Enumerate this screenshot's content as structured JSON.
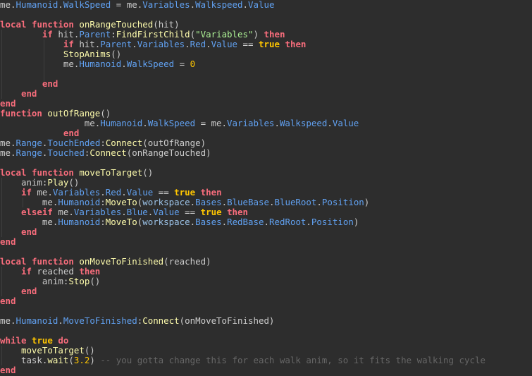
{
  "code": {
    "lines": [
      [
        [
          "plain",
          "me."
        ],
        [
          "prop",
          "Humanoid"
        ],
        [
          "plain",
          "."
        ],
        [
          "prop",
          "WalkSpeed"
        ],
        [
          "plain",
          " = me."
        ],
        [
          "prop",
          "Variables"
        ],
        [
          "plain",
          "."
        ],
        [
          "prop",
          "Walkspeed"
        ],
        [
          "plain",
          "."
        ],
        [
          "prop",
          "Value"
        ]
      ],
      [],
      [
        [
          "kw",
          "local"
        ],
        [
          "plain",
          " "
        ],
        [
          "kw",
          "function"
        ],
        [
          "plain",
          " "
        ],
        [
          "fn",
          "onRangeTouched"
        ],
        [
          "plain",
          "(hit)"
        ]
      ],
      [
        [
          "plain",
          "        "
        ],
        [
          "kw",
          "if"
        ],
        [
          "plain",
          " hit."
        ],
        [
          "prop",
          "Parent"
        ],
        [
          "plain",
          ":"
        ],
        [
          "fn",
          "FindFirstChild"
        ],
        [
          "plain",
          "("
        ],
        [
          "str",
          "\"Variables\""
        ],
        [
          "plain",
          ") "
        ],
        [
          "kw",
          "then"
        ]
      ],
      [
        [
          "plain",
          "            "
        ],
        [
          "kw",
          "if"
        ],
        [
          "plain",
          " hit."
        ],
        [
          "prop",
          "Parent"
        ],
        [
          "plain",
          "."
        ],
        [
          "prop",
          "Variables"
        ],
        [
          "plain",
          "."
        ],
        [
          "prop",
          "Red"
        ],
        [
          "plain",
          "."
        ],
        [
          "prop",
          "Value"
        ],
        [
          "plain",
          " == "
        ],
        [
          "bool",
          "true"
        ],
        [
          "plain",
          " "
        ],
        [
          "kw",
          "then"
        ]
      ],
      [
        [
          "plain",
          "            "
        ],
        [
          "fn",
          "StopAnims"
        ],
        [
          "plain",
          "()"
        ]
      ],
      [
        [
          "plain",
          "            me."
        ],
        [
          "prop",
          "Humanoid"
        ],
        [
          "plain",
          "."
        ],
        [
          "prop",
          "WalkSpeed"
        ],
        [
          "plain",
          " = "
        ],
        [
          "num",
          "0"
        ]
      ],
      [],
      [
        [
          "plain",
          "        "
        ],
        [
          "kw",
          "end"
        ]
      ],
      [
        [
          "plain",
          "    "
        ],
        [
          "kw",
          "end"
        ]
      ],
      [
        [
          "kw",
          "end"
        ]
      ],
      [
        [
          "kw",
          "function"
        ],
        [
          "plain",
          " "
        ],
        [
          "fn",
          "outOfRange"
        ],
        [
          "plain",
          "()"
        ]
      ],
      [
        [
          "plain",
          "                me."
        ],
        [
          "prop",
          "Humanoid"
        ],
        [
          "plain",
          "."
        ],
        [
          "prop",
          "WalkSpeed"
        ],
        [
          "plain",
          " = me."
        ],
        [
          "prop",
          "Variables"
        ],
        [
          "plain",
          "."
        ],
        [
          "prop",
          "Walkspeed"
        ],
        [
          "plain",
          "."
        ],
        [
          "prop",
          "Value"
        ]
      ],
      [
        [
          "plain",
          "            "
        ],
        [
          "kw",
          "end"
        ]
      ],
      [
        [
          "plain",
          "me."
        ],
        [
          "prop",
          "Range"
        ],
        [
          "plain",
          "."
        ],
        [
          "prop",
          "TouchEnded"
        ],
        [
          "plain",
          ":"
        ],
        [
          "fn",
          "Connect"
        ],
        [
          "plain",
          "(outOfRange)"
        ]
      ],
      [
        [
          "plain",
          "me."
        ],
        [
          "prop",
          "Range"
        ],
        [
          "plain",
          "."
        ],
        [
          "prop",
          "Touched"
        ],
        [
          "plain",
          ":"
        ],
        [
          "fn",
          "Connect"
        ],
        [
          "plain",
          "(onRangeTouched)"
        ]
      ],
      [],
      [
        [
          "kw",
          "local"
        ],
        [
          "plain",
          " "
        ],
        [
          "kw",
          "function"
        ],
        [
          "plain",
          " "
        ],
        [
          "fn",
          "moveToTarget"
        ],
        [
          "plain",
          "()"
        ]
      ],
      [
        [
          "plain",
          "    anim:"
        ],
        [
          "fn",
          "Play"
        ],
        [
          "plain",
          "()"
        ]
      ],
      [
        [
          "plain",
          "    "
        ],
        [
          "kw",
          "if"
        ],
        [
          "plain",
          " me."
        ],
        [
          "prop",
          "Variables"
        ],
        [
          "plain",
          "."
        ],
        [
          "prop",
          "Red"
        ],
        [
          "plain",
          "."
        ],
        [
          "prop",
          "Value"
        ],
        [
          "plain",
          " == "
        ],
        [
          "bool",
          "true"
        ],
        [
          "plain",
          " "
        ],
        [
          "kw",
          "then"
        ]
      ],
      [
        [
          "plain",
          "        me."
        ],
        [
          "prop",
          "Humanoid"
        ],
        [
          "plain",
          ":"
        ],
        [
          "fn",
          "MoveTo"
        ],
        [
          "plain",
          "("
        ],
        [
          "builtin",
          "workspace"
        ],
        [
          "plain",
          "."
        ],
        [
          "prop",
          "Bases"
        ],
        [
          "plain",
          "."
        ],
        [
          "prop",
          "BlueBase"
        ],
        [
          "plain",
          "."
        ],
        [
          "prop",
          "BlueRoot"
        ],
        [
          "plain",
          "."
        ],
        [
          "prop",
          "Position"
        ],
        [
          "plain",
          ")"
        ]
      ],
      [
        [
          "plain",
          "    "
        ],
        [
          "kw",
          "elseif"
        ],
        [
          "plain",
          " me."
        ],
        [
          "prop",
          "Variables"
        ],
        [
          "plain",
          "."
        ],
        [
          "prop",
          "Blue"
        ],
        [
          "plain",
          "."
        ],
        [
          "prop",
          "Value"
        ],
        [
          "plain",
          " == "
        ],
        [
          "bool",
          "true"
        ],
        [
          "plain",
          " "
        ],
        [
          "kw",
          "then"
        ]
      ],
      [
        [
          "plain",
          "        me."
        ],
        [
          "prop",
          "Humanoid"
        ],
        [
          "plain",
          ":"
        ],
        [
          "fn",
          "MoveTo"
        ],
        [
          "plain",
          "("
        ],
        [
          "builtin",
          "workspace"
        ],
        [
          "plain",
          "."
        ],
        [
          "prop",
          "Bases"
        ],
        [
          "plain",
          "."
        ],
        [
          "prop",
          "RedBase"
        ],
        [
          "plain",
          "."
        ],
        [
          "prop",
          "RedRoot"
        ],
        [
          "plain",
          "."
        ],
        [
          "prop",
          "Position"
        ],
        [
          "plain",
          ")"
        ]
      ],
      [
        [
          "plain",
          "    "
        ],
        [
          "kw",
          "end"
        ]
      ],
      [
        [
          "kw",
          "end"
        ]
      ],
      [],
      [
        [
          "kw",
          "local"
        ],
        [
          "plain",
          " "
        ],
        [
          "kw",
          "function"
        ],
        [
          "plain",
          " "
        ],
        [
          "fn",
          "onMoveToFinished"
        ],
        [
          "plain",
          "(reached)"
        ]
      ],
      [
        [
          "plain",
          "    "
        ],
        [
          "kw",
          "if"
        ],
        [
          "plain",
          " reached "
        ],
        [
          "kw",
          "then"
        ]
      ],
      [
        [
          "plain",
          "        anim:"
        ],
        [
          "fn",
          "Stop"
        ],
        [
          "plain",
          "()"
        ]
      ],
      [
        [
          "plain",
          "    "
        ],
        [
          "kw",
          "end"
        ]
      ],
      [
        [
          "kw",
          "end"
        ]
      ],
      [],
      [
        [
          "plain",
          "me."
        ],
        [
          "prop",
          "Humanoid"
        ],
        [
          "plain",
          "."
        ],
        [
          "prop",
          "MoveToFinished"
        ],
        [
          "plain",
          ":"
        ],
        [
          "fn",
          "Connect"
        ],
        [
          "plain",
          "(onMoveToFinished)"
        ]
      ],
      [],
      [
        [
          "kw",
          "while"
        ],
        [
          "plain",
          " "
        ],
        [
          "bool",
          "true"
        ],
        [
          "plain",
          " "
        ],
        [
          "kw",
          "do"
        ]
      ],
      [
        [
          "plain",
          "    "
        ],
        [
          "fn",
          "moveToTarget"
        ],
        [
          "plain",
          "()"
        ]
      ],
      [
        [
          "plain",
          "    task."
        ],
        [
          "fn",
          "wait"
        ],
        [
          "plain",
          "("
        ],
        [
          "num",
          "3.2"
        ],
        [
          "plain",
          ") "
        ],
        [
          "cmt",
          "-- you gotta change this for each walk anim, so it fits the walking cycle"
        ]
      ],
      [
        [
          "kw",
          "end"
        ]
      ]
    ]
  }
}
